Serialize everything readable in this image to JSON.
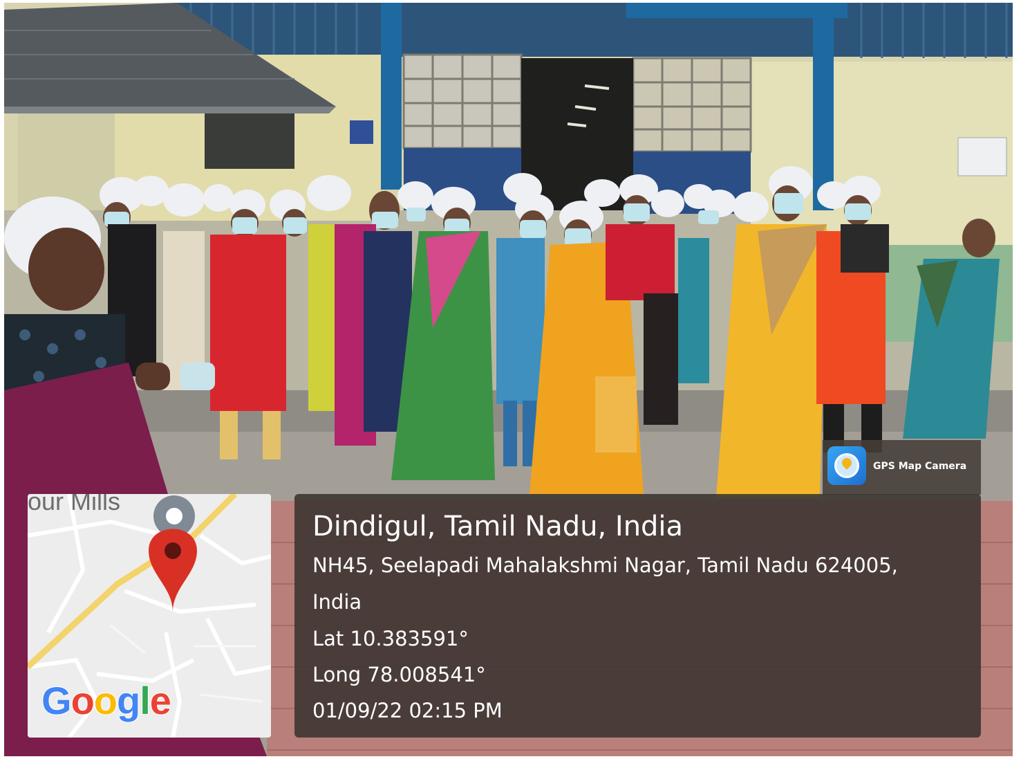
{
  "photo": {
    "subject": "group-of-workers-in-hairnets-and-masks-outside-factory",
    "icons": [
      "gps-map-camera-icon",
      "location-pin-icon",
      "map-marker-icon"
    ]
  },
  "gps_badge": {
    "label": "GPS Map Camera"
  },
  "location": {
    "place": "Dindigul, Tamil Nadu, India",
    "address_line1": "NH45, Seelapadi Mahalakshmi Nagar, Tamil Nadu 624005,",
    "address_line2": "India",
    "latitude": "Lat 10.383591°",
    "longitude": "Long 78.008541°",
    "datetime": "01/09/22 02:15 PM"
  },
  "map": {
    "road_label": "our Mills",
    "provider": "Google",
    "pin_color": "#d93025"
  }
}
